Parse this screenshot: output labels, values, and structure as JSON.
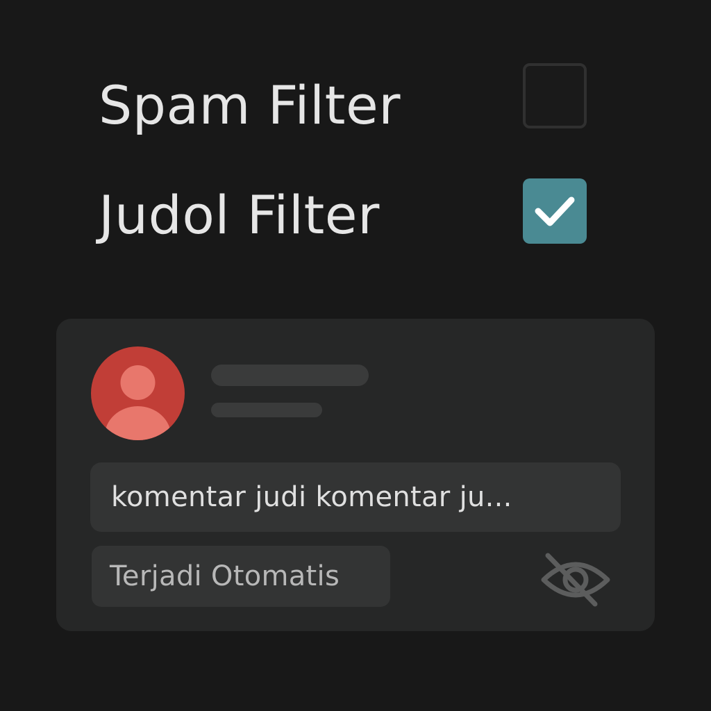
{
  "filters": {
    "spam": {
      "label": "Spam Filter",
      "checked": false
    },
    "judol": {
      "label": "Judol Filter",
      "checked": true
    }
  },
  "colors": {
    "background": "#181818",
    "checkbox_checked": "#4a8a93",
    "avatar": "#c13e37",
    "card": "#262727"
  },
  "comment": {
    "text": "komentar judi komentar ju...",
    "status": "Terjadi Otomatis",
    "avatar_icon": "user-avatar-icon",
    "visibility_icon": "eye-off-icon"
  }
}
